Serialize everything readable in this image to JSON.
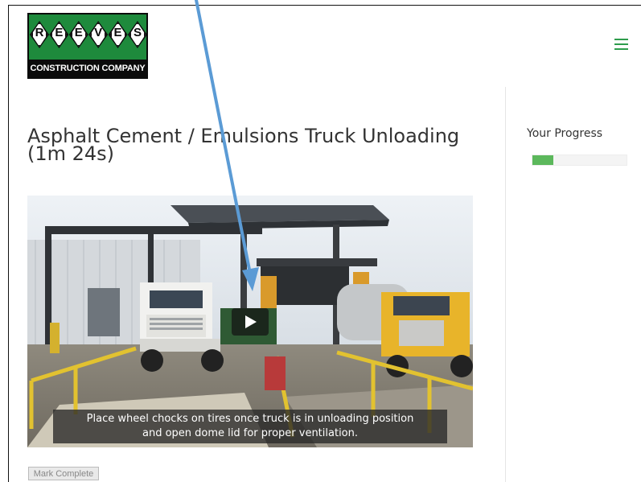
{
  "logo": {
    "letters": [
      "R",
      "E",
      "E",
      "V",
      "E",
      "S"
    ],
    "caption": "CONSTRUCTION COMPANY"
  },
  "header": {
    "menu_icon": "hamburger-menu-icon",
    "accent": "#2e9c4c"
  },
  "lesson": {
    "title": "Asphalt Cement / Emulsions Truck Unloading (1m 24s)"
  },
  "video": {
    "subtitle_line1": "Place wheel chocks on tires once truck is in unloading position",
    "subtitle_line2": "and open dome lid for proper ventilation.",
    "play_icon": "play-icon"
  },
  "sidebar": {
    "progress_label": "Your Progress",
    "progress_value": 0.22,
    "progress_color": "#5cb85c"
  },
  "actions": {
    "mark_complete_label": "Mark Complete"
  },
  "annotation": {
    "icon": "arrow-annotation-icon",
    "color": "#5b9bd5"
  }
}
